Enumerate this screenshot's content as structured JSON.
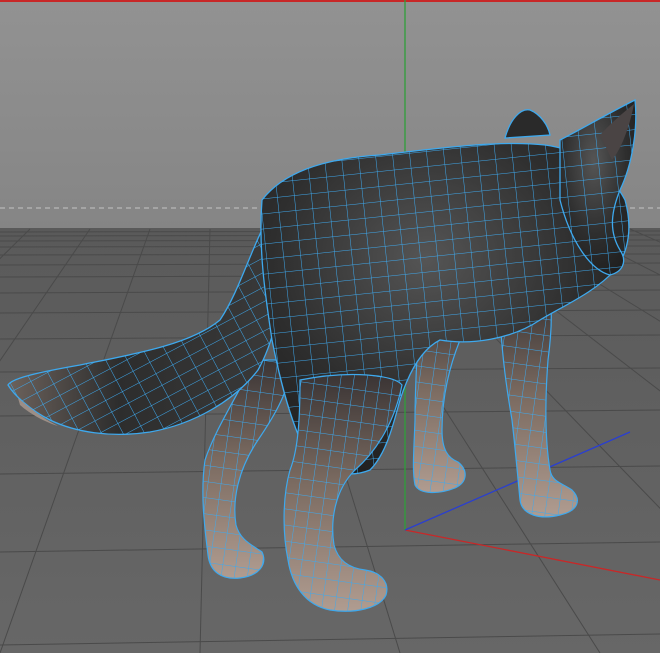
{
  "viewport": {
    "view": "perspective",
    "model": "wolf",
    "display_mode": "gouraud-shading-with-wireframe",
    "colors": {
      "background_top": "#8e8e8e",
      "background_bottom": "#6c6c6c",
      "floor": "#5f5f5f",
      "grid_line": "#4b4b4b",
      "horizon_line": "#c4c4c4",
      "x_axis": "#c82828",
      "y_axis": "#2f9f3a",
      "z_axis": "#2a3fd0",
      "wireframe": "#3ea9ee",
      "fur_dark": "#2b2b2b",
      "fur_light": "#9a8a7e"
    }
  }
}
